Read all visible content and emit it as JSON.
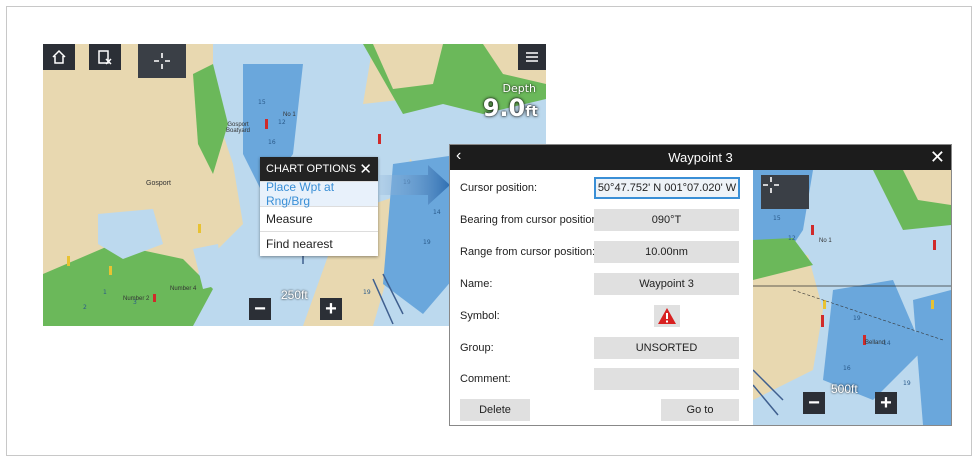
{
  "left_chart": {
    "depth_label": "Depth",
    "depth_value": "9.0",
    "depth_unit": "ft",
    "scale": "250ft",
    "place_names": [
      "Gosport",
      "Gosport Boatyard",
      "No 1",
      "Number 4",
      "Number 2"
    ],
    "toolbar": {
      "home_icon": "home-icon",
      "waypoint_icon": "waypoint-flag-icon",
      "cursor_icon": "crosshair-icon",
      "menu_icon": "menu-icon"
    }
  },
  "chart_options": {
    "title": "CHART OPTIONS",
    "items": [
      "Place Wpt at Rng/Brg",
      "Measure",
      "Find nearest"
    ]
  },
  "dialog": {
    "title": "Waypoint 3",
    "fields": [
      {
        "label": "Cursor position:",
        "value": "50°47.752' N  001°07.020' W"
      },
      {
        "label": "Bearing from cursor position:",
        "value": "090°T"
      },
      {
        "label": "Range from cursor position:",
        "value": "10.00nm"
      },
      {
        "label": "Name:",
        "value": "Waypoint 3"
      },
      {
        "label": "Symbol:",
        "value": ""
      },
      {
        "label": "Group:",
        "value": "UNSORTED"
      },
      {
        "label": "Comment:",
        "value": ""
      }
    ],
    "delete_label": "Delete",
    "goto_label": "Go to"
  },
  "right_map": {
    "scale": "500ft",
    "place_names": [
      "No 1",
      "Belland"
    ]
  },
  "colors": {
    "land": "#e8d8b0",
    "water": "#bcd9ee",
    "deep": "#3f86c6",
    "green": "#6bb85a",
    "accent": "#3a8fd6"
  }
}
